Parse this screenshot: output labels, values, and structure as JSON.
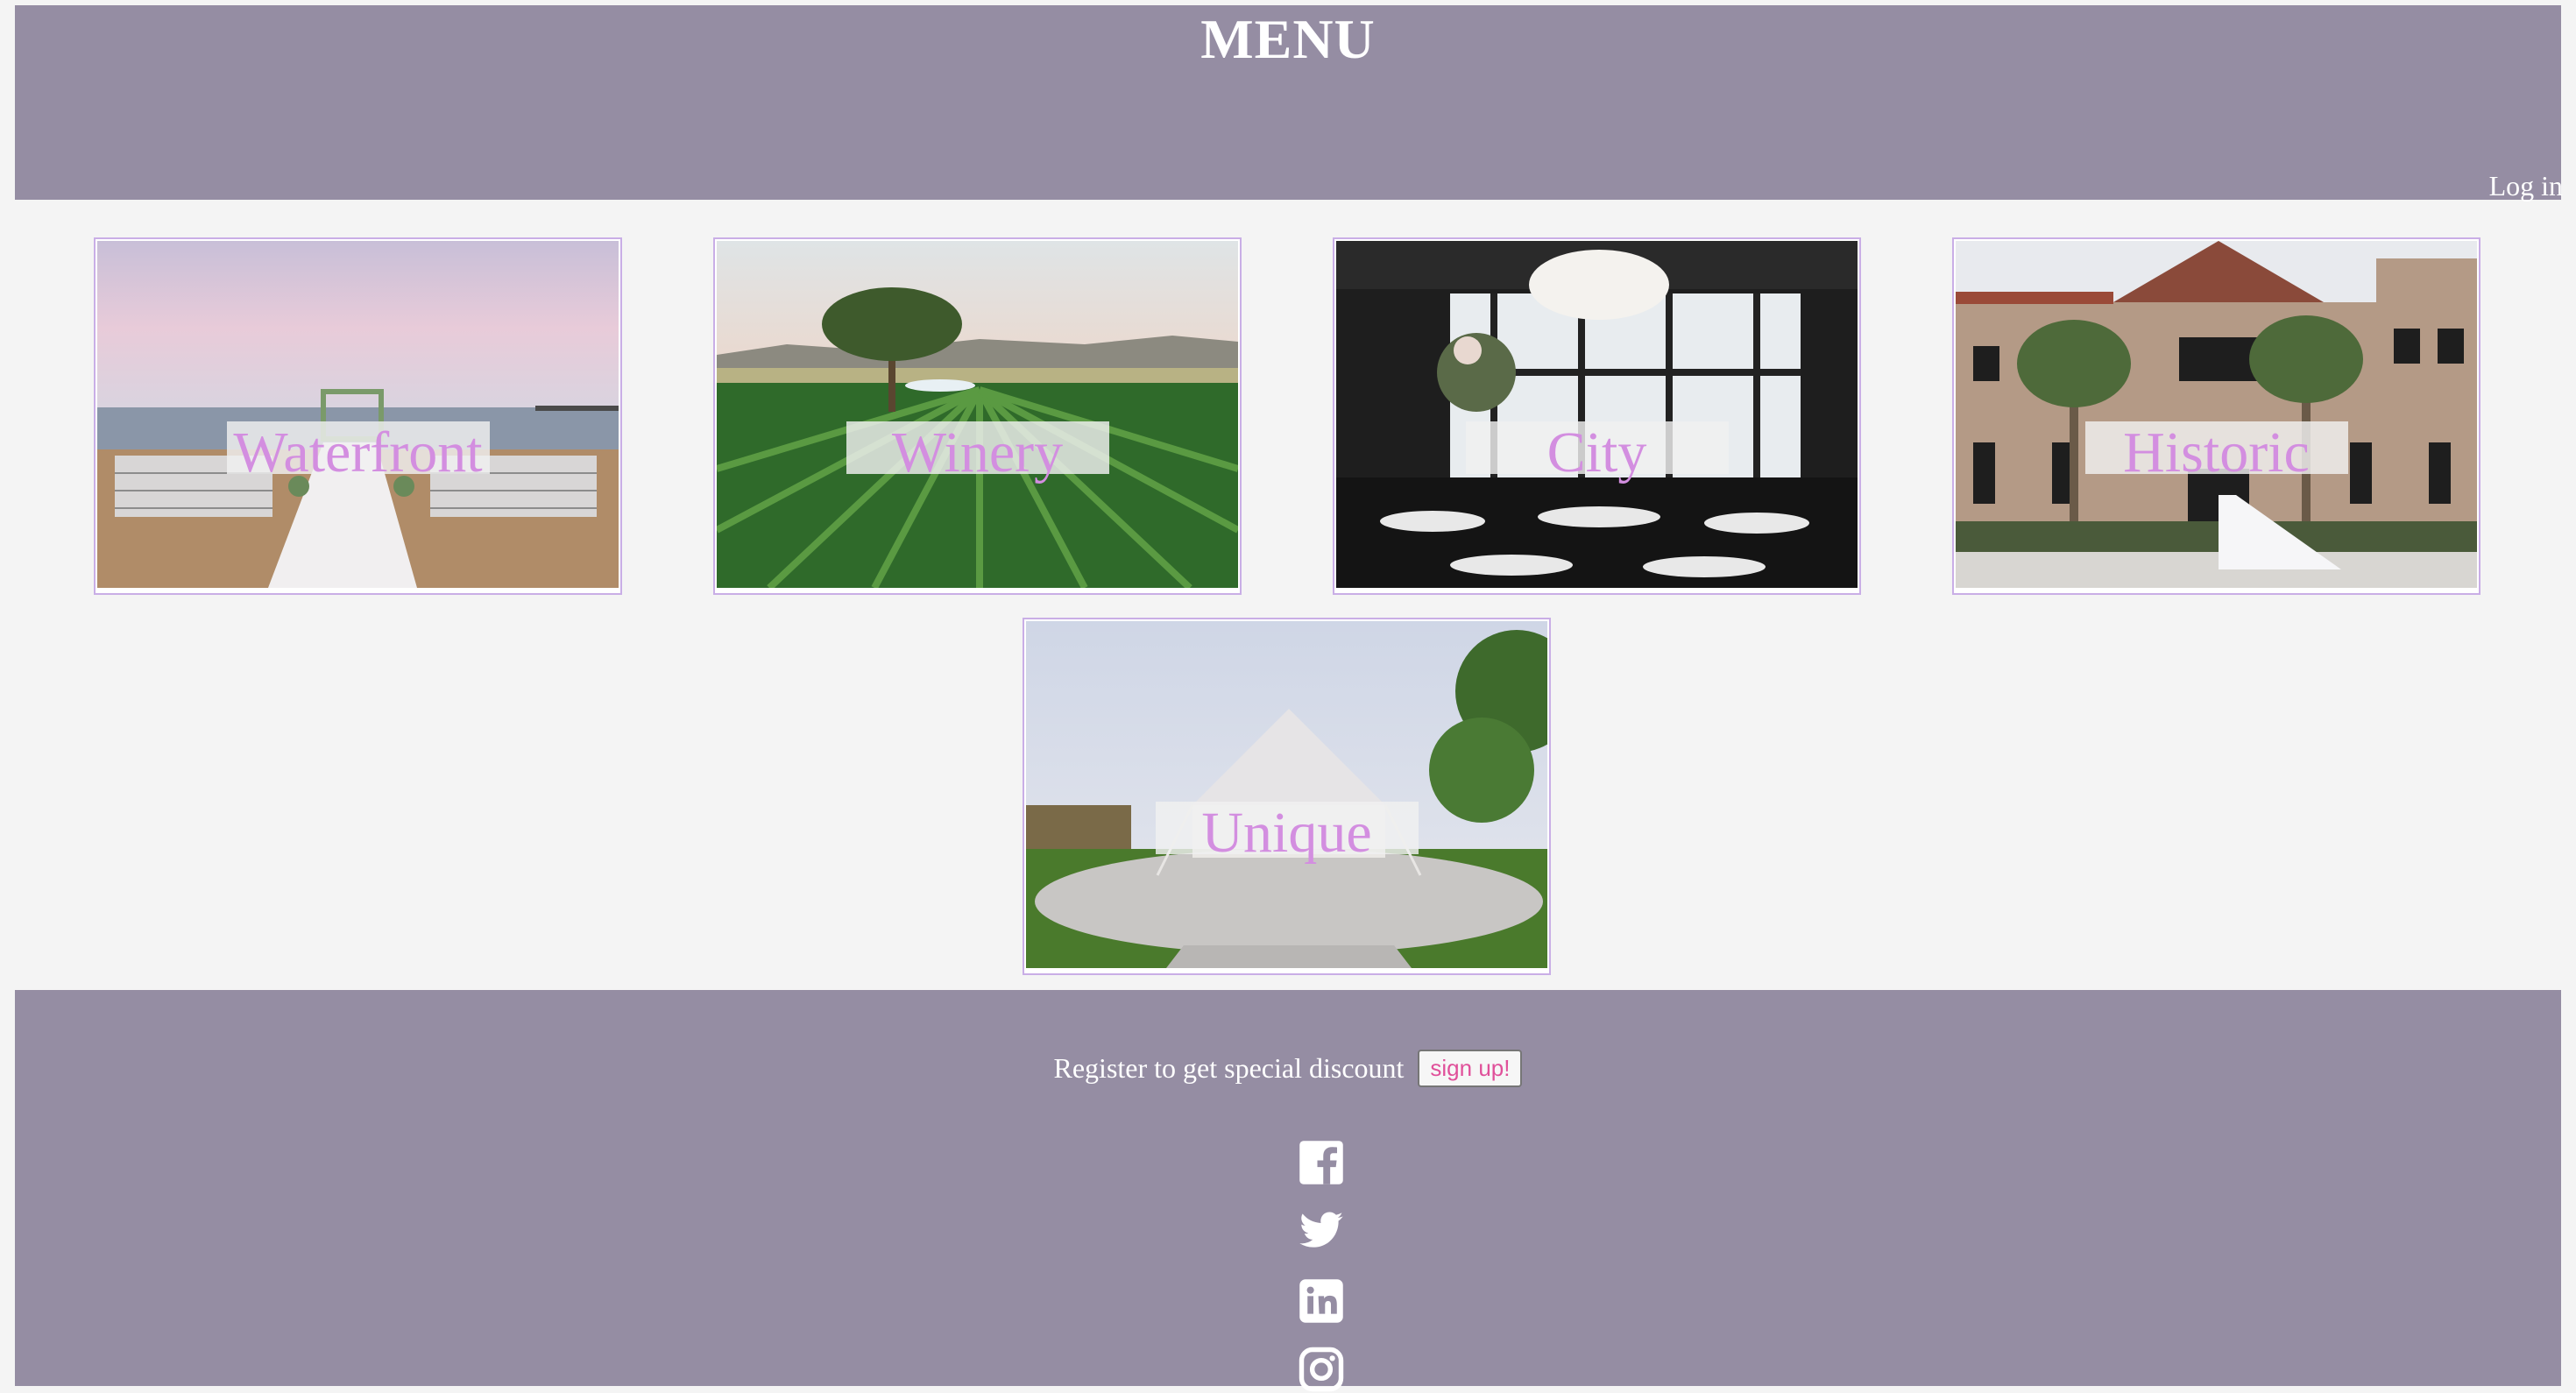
{
  "header": {
    "title": "MENU",
    "login_label": "Log in",
    "background_color": "#958da3"
  },
  "venues": [
    {
      "label": "Waterfront",
      "photo": "beach-ceremony-photo"
    },
    {
      "label": "Winery",
      "photo": "vineyard-photo"
    },
    {
      "label": "City",
      "photo": "city-loft-ballroom-photo"
    },
    {
      "label": "Historic",
      "photo": "historic-mansion-photo"
    },
    {
      "label": "Unique",
      "photo": "tent-garden-photo"
    }
  ],
  "footer": {
    "register_text": "Register to get special discount",
    "signup_label": "sign up!",
    "social_icons": [
      "facebook-icon",
      "twitter-icon",
      "linkedin-icon",
      "instagram-icon"
    ]
  },
  "colors": {
    "accent": "#d38ee0",
    "card_border": "#c9aee6",
    "page_background": "#f4f4f4"
  }
}
